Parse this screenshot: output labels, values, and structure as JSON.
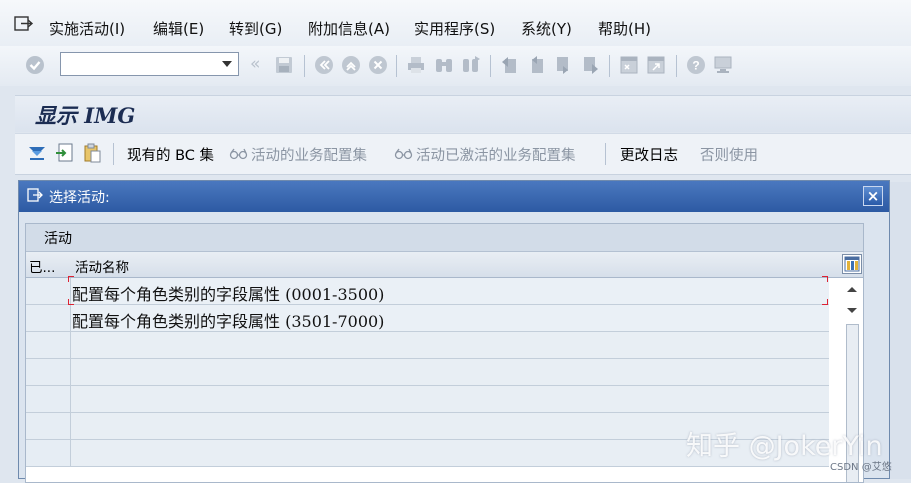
{
  "menubar": {
    "items": [
      {
        "label": "实施活动(I)"
      },
      {
        "label": "编辑(E)"
      },
      {
        "label": "转到(G)"
      },
      {
        "label": "附加信息(A)"
      },
      {
        "label": "实用程序(S)"
      },
      {
        "label": "系统(Y)"
      },
      {
        "label": "帮助(H)"
      }
    ]
  },
  "toolbar": {
    "command_field_value": "",
    "icons": [
      "check-icon",
      "back-icon",
      "save-icon",
      "back-nav-icon",
      "exit-icon",
      "cancel-icon",
      "print-icon",
      "find-icon",
      "find-next-icon",
      "first-page-icon",
      "prev-page-icon",
      "next-page-icon",
      "last-page-icon",
      "create-session-icon",
      "shortcut-icon",
      "help-icon",
      "customize-icon"
    ]
  },
  "screen": {
    "title": "显示 IMG"
  },
  "app_toolbar": {
    "existing_bc_sets": "现有的 BC 集",
    "bc_sets_for_activity": "活动的业务配置集",
    "activated_bc_sets": "活动已激活的业务配置集",
    "change_log": "更改日志",
    "where_used": "否则使用"
  },
  "dialog": {
    "title": "选择活动:",
    "table_title": "活动",
    "columns": [
      "已...",
      "活动名称"
    ],
    "rows": [
      {
        "name": "配置每个角色类别的字段属性 (0001-3500)"
      },
      {
        "name": "配置每个角色类别的字段属性 (3501-7000)"
      }
    ]
  },
  "watermark": {
    "main": "知乎 @JokerYin",
    "sub": "CSDN @艾悠"
  },
  "colors": {
    "dialog_title_bg": "#3b68b1",
    "accent": "#1b2c52",
    "disabled_text": "#8b95a3"
  }
}
